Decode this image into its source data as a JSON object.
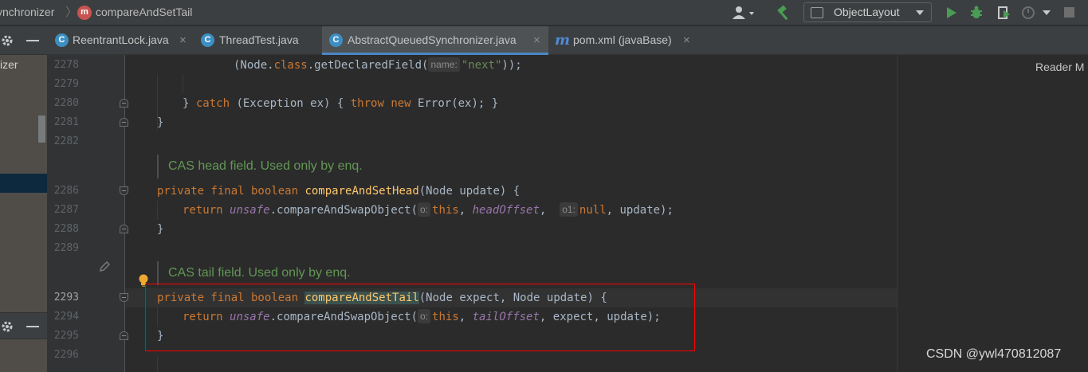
{
  "breadcrumb": {
    "parent": "ynchronizer",
    "current": "compareAndSetTail",
    "separator": "〉",
    "method_badge": "m"
  },
  "toolbar": {
    "run_config": "ObjectLayout"
  },
  "project_panel": {
    "label": "izer"
  },
  "tabs": [
    {
      "label": "ReentrantLock.java",
      "icon": "C",
      "close": "×"
    },
    {
      "label": "ThreadTest.java",
      "icon": "C",
      "close": ""
    },
    {
      "label": "AbstractQueuedSynchronizer.java",
      "icon": "C",
      "close": "×"
    },
    {
      "label": "pom.xml (javaBase)",
      "icon": "m",
      "close": "×"
    }
  ],
  "reader_mode": "Reader M",
  "watermark": "CSDN @ywl470812087",
  "lines": {
    "n2278": "2278",
    "n2279": "2279",
    "n2280": "2280",
    "n2281": "2281",
    "n2282": "2282",
    "n2286": "2286",
    "n2287": "2287",
    "n2288": "2288",
    "n2289": "2289",
    "n2293": "2293",
    "n2294": "2294",
    "n2295": "2295",
    "n2296": "2296"
  },
  "code": {
    "l2278": {
      "a": "(Node.",
      "kw": "class",
      "b": ".getDeclaredField(",
      "hint": "name:",
      "str": "\"next\"",
      "c": "));"
    },
    "l2280": {
      "a": "} ",
      "kw1": "catch",
      "b": " (Exception ex) { ",
      "kw2": "throw",
      "c": " ",
      "kw3": "new",
      "d": " Error(ex); }"
    },
    "l2281": "}",
    "doc1": "CAS head field. Used only by enq.",
    "l2286": {
      "kw": "private final boolean",
      "sp": " ",
      "method": "compareAndSetHead",
      "rest": "(Node update) {"
    },
    "l2287": {
      "kw": "return",
      "sp": " ",
      "field": "unsafe",
      "a": ".compareAndSwapObject(",
      "hint1": "o:",
      "kw2": "this",
      "b": ", ",
      "field2": "headOffset",
      "c": ",  ",
      "hint2": "o1:",
      "kw3": "null",
      "d": ", update);"
    },
    "l2288": "}",
    "doc2": "CAS tail field. Used only by enq.",
    "l2293": {
      "kw": "private final boolean",
      "sp": " ",
      "method": "compareAndSetTail",
      "rest": "(Node expect, Node update) {"
    },
    "l2294": {
      "kw": "return",
      "sp": " ",
      "field": "unsafe",
      "a": ".compareAndSwapObject(",
      "hint1": "o:",
      "kw2": "this",
      "b": ", ",
      "field2": "tailOffset",
      "c": ", expect, update);"
    },
    "l2295": "}"
  },
  "colors": {
    "keyword": "#cc7832",
    "method": "#ffc66d",
    "field": "#9876aa",
    "string": "#6a8759",
    "doc": "#629755",
    "highlight_box": "#ff0000"
  }
}
